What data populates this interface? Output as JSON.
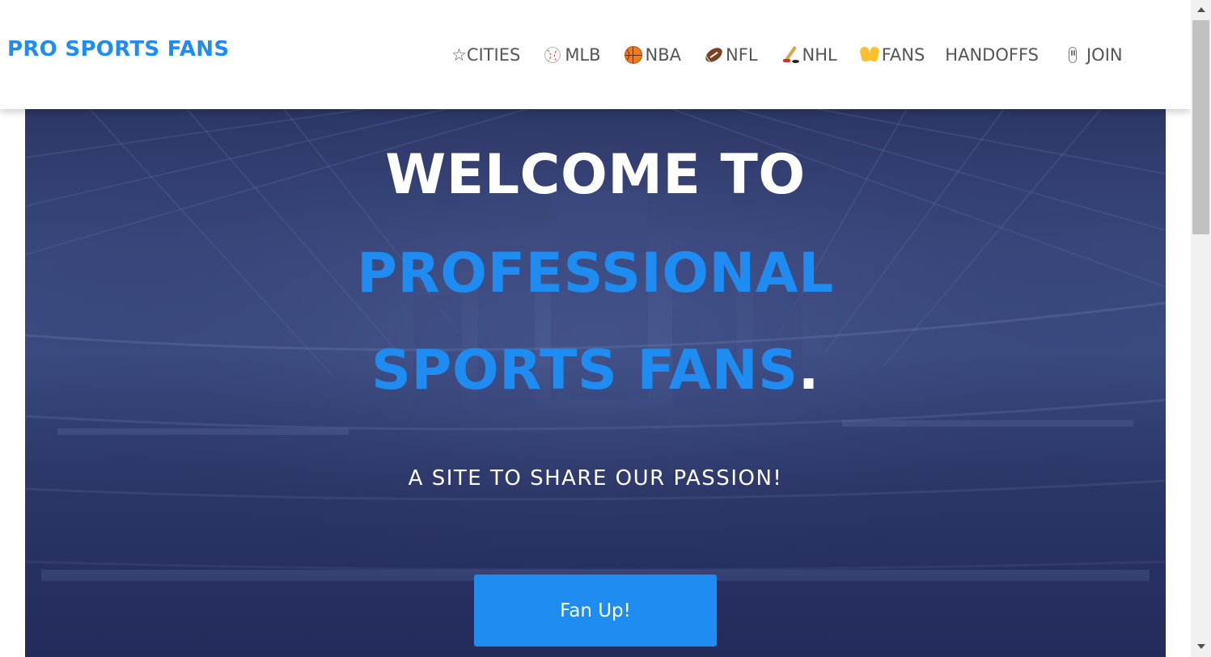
{
  "header": {
    "logo": "PRO SPORTS FANS",
    "nav": [
      {
        "icon": "star-icon",
        "label": "☆CITIES"
      },
      {
        "icon": "baseball-icon",
        "label": "MLB"
      },
      {
        "icon": "basketball-icon",
        "label": "NBA"
      },
      {
        "icon": "football-icon",
        "label": "NFL"
      },
      {
        "icon": "hockey-icon",
        "label": "NHL"
      },
      {
        "icon": "raised-hands-icon",
        "label": "FANS"
      },
      {
        "icon": "",
        "label": "HANDOFFS"
      },
      {
        "icon": "join-icon",
        "label": "JOIN"
      }
    ]
  },
  "hero": {
    "line1": "WELCOME TO",
    "line2": "PROFESSIONAL",
    "line3": "SPORTS FANS",
    "period": ".",
    "subtitle": "A SITE TO SHARE OUR PASSION!",
    "cta": "Fan Up!"
  },
  "colors": {
    "accent": "#1e8cf0",
    "hero_overlay": "#2f3a6c",
    "nav_text": "#555555"
  }
}
